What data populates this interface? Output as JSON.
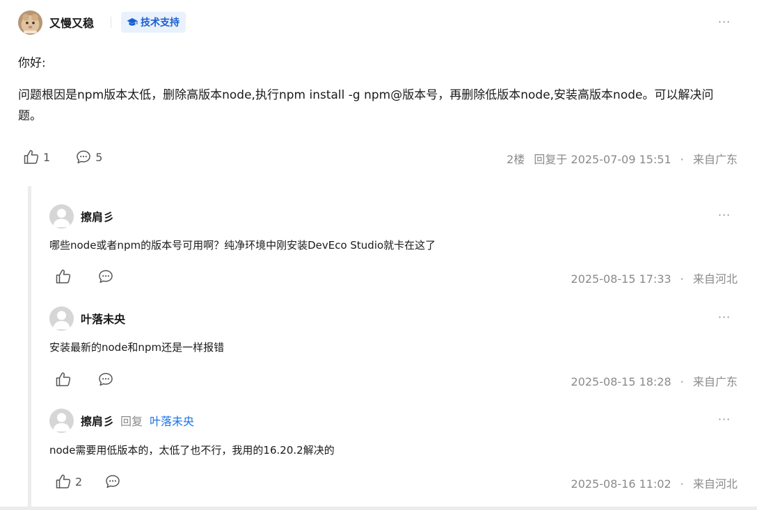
{
  "post": {
    "author": "又慢又稳",
    "badge": "技术支持",
    "greeting": "你好:",
    "body": "问题根因是npm版本太低，删除高版本node,执行npm install -g npm@版本号，再删除低版本node,安装高版本node。可以解决问题。",
    "likes": "1",
    "comments": "5",
    "floor": "2楼",
    "reply_label": "回复于",
    "datetime": "2025-07-09 15:51",
    "location": "来自广东",
    "more": "···"
  },
  "replies": [
    {
      "author": "擦肩彡",
      "text": "哪些node或者npm的版本号可用啊？纯净环境中刚安装DevEco Studio就卡在这了",
      "datetime": "2025-08-15 17:33",
      "location": "来自河北",
      "likes": "",
      "more": "···"
    },
    {
      "author": "叶落未央",
      "text": "安装最新的node和npm还是一样报错",
      "datetime": "2025-08-15 18:28",
      "location": "来自广东",
      "likes": "",
      "more": "···"
    },
    {
      "author": "擦肩彡",
      "reply_word": "回复",
      "reply_target": "叶落未央",
      "text": "node需要用低版本的，太低了也不行，我用的16.20.2解决的",
      "datetime": "2025-08-16 11:02",
      "location": "来自河北",
      "likes": "2",
      "more": "···"
    }
  ],
  "separator": "·",
  "icons": {
    "like": "thumbs-up-icon",
    "comment": "comment-bubble-icon",
    "badge": "graduation-cap-icon",
    "more": "more-dots-icon"
  },
  "colors": {
    "accent": "#1b74e4",
    "badge_bg": "#e9f1fc",
    "badge_text": "#1a5fd0",
    "meta": "#8a8a8a"
  }
}
